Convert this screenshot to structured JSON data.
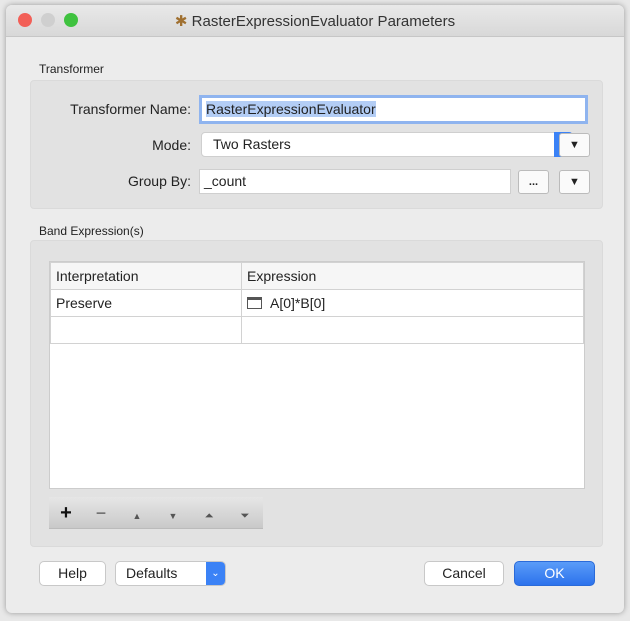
{
  "window": {
    "title": "RasterExpressionEvaluator Parameters"
  },
  "transformer": {
    "section_label": "Transformer",
    "name_label": "Transformer Name:",
    "name_value": "RasterExpressionEvaluator",
    "mode_label": "Mode:",
    "mode_value": "Two Rasters",
    "group_by_label": "Group By:",
    "group_by_value": "_count",
    "ellipsis": "..."
  },
  "band": {
    "section_label": "Band Expression(s)",
    "columns": [
      "Interpretation",
      "Expression"
    ],
    "rows": [
      {
        "interpretation": "Preserve",
        "expression": "A[0]*B[0]"
      }
    ]
  },
  "toolbar": {
    "add": "+",
    "remove": "−",
    "up": "▲",
    "down": "▼",
    "top": "⏶",
    "bottom": "⏷"
  },
  "footer": {
    "help": "Help",
    "defaults": "Defaults",
    "cancel": "Cancel",
    "ok": "OK"
  },
  "colors": {
    "accent": "#3b82f6"
  }
}
